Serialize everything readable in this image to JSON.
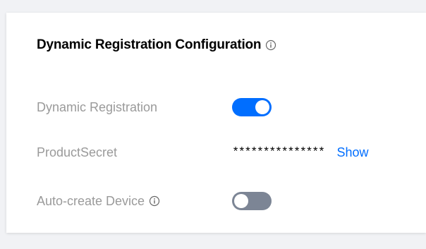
{
  "section": {
    "title": "Dynamic Registration Configuration"
  },
  "rows": [
    {
      "label": "Dynamic Registration",
      "toggle_on": true
    },
    {
      "label": "ProductSecret",
      "value": "***************",
      "action_label": "Show"
    },
    {
      "label": "Auto-create Device",
      "toggle_on": false
    }
  ],
  "colors": {
    "accent": "#006eff",
    "toggle_off": "#7c8595",
    "label": "#9a9a9a",
    "background": "#f1f2f5"
  },
  "icons": {
    "info": "info-circle-icon"
  }
}
